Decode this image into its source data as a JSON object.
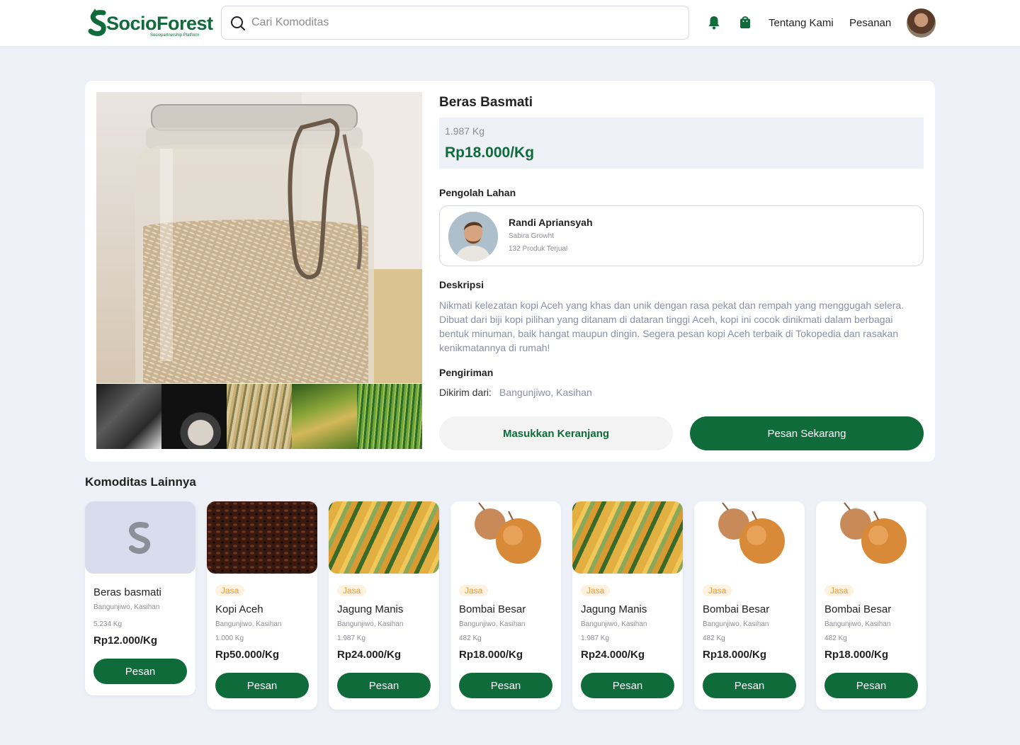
{
  "header": {
    "logo_text": "SocioForest",
    "logo_tagline": "Sociopartnership Platform",
    "search_placeholder": "Cari Komoditas",
    "nav": [
      "Tentang Kami",
      "Pesanan"
    ]
  },
  "product": {
    "title": "Beras Basmati",
    "stock": "1.987 Kg",
    "price": "Rp18.000/Kg",
    "seller_section_label": "Pengolah Lahan",
    "seller": {
      "name": "Randi Apriansyah",
      "company": "Sabira Growht",
      "sold": "132 Produk Terjual"
    },
    "description_label": "Deskripsi",
    "description": "Nikmati kelezatan kopi Aceh yang khas dan unik dengan rasa pekat dan rempah yang menggugah selera. Dibuat dari biji kopi pilihan yang ditanam di dataran tinggi Aceh, kopi ini cocok dinikmati dalam berbagai bentuk minuman, baik hangat maupun dingin. Segera pesan kopi Aceh terbaik di Tokopedia dan rasakan kenikmatannya di rumah!",
    "shipping_label": "Pengiriman",
    "shipping_from_label": "Dikirim dari:",
    "shipping_from": "Bangunjiwo, Kasihan",
    "cart_button": "Masukkan Keranjang",
    "buy_button": "Pesan Sekarang"
  },
  "others": {
    "title": "Komoditas Lainnya",
    "items": [
      {
        "name": "Beras basmati",
        "tag": "",
        "location": "Bangunjiwo, Kasihan",
        "qty": "5.234 Kg",
        "price": "Rp12.000/Kg",
        "button": "Pesan",
        "image": "logo-placeholder"
      },
      {
        "name": "Kopi Aceh",
        "tag": "Jasa",
        "location": "Bangunjiwo, Kasihan",
        "qty": "1.000 Kg",
        "price": "Rp50.000/Kg",
        "button": "Pesan",
        "image": "coffee-beans"
      },
      {
        "name": "Jagung Manis",
        "tag": "Jasa",
        "location": "Bangunjiwo, Kasihan",
        "qty": "1.987 Kg",
        "price": "Rp24.000/Kg",
        "button": "Pesan",
        "image": "corn"
      },
      {
        "name": "Bombai Besar",
        "tag": "Jasa",
        "location": "Bangunjiwo, Kasihan",
        "qty": "482 Kg",
        "price": "Rp18.000/Kg",
        "button": "Pesan",
        "image": "onion"
      },
      {
        "name": "Jagung Manis",
        "tag": "Jasa",
        "location": "Bangunjiwo, Kasihan",
        "qty": "1.987 Kg",
        "price": "Rp24.000/Kg",
        "button": "Pesan",
        "image": "corn"
      },
      {
        "name": "Bombai Besar",
        "tag": "Jasa",
        "location": "Bangunjiwo, Kasihan",
        "qty": "482 Kg",
        "price": "Rp18.000/Kg",
        "button": "Pesan",
        "image": "onion"
      },
      {
        "name": "Bombai Besar",
        "tag": "Jasa",
        "location": "Bangunjiwo, Kasihan",
        "qty": "482 Kg",
        "price": "Rp18.000/Kg",
        "button": "Pesan",
        "image": "onion"
      }
    ]
  },
  "colors": {
    "brand": "#0f6b3a",
    "background": "#eef0f8",
    "tag": "#e89a3a"
  },
  "icons": [
    "search-icon",
    "bell-icon",
    "shopping-bag-icon"
  ]
}
